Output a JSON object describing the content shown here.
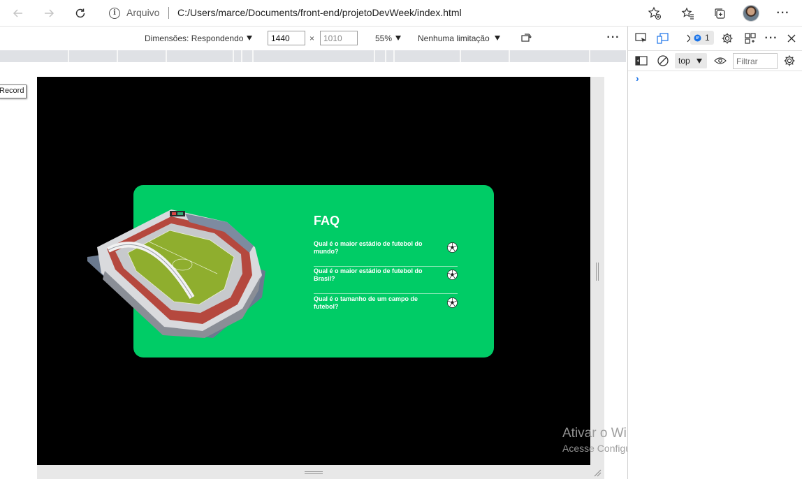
{
  "browser": {
    "site_label": "Arquivo",
    "url": "C:/Users/marce/Documents/front-end/projetoDevWeek/index.html",
    "icons": [
      "back-icon",
      "forward-icon",
      "refresh-icon",
      "info-icon",
      "add-favorite-icon",
      "favorites-icon",
      "collections-icon",
      "avatar",
      "more-icon"
    ]
  },
  "device_toolbar": {
    "dimensions_label": "Dimensões: Respondendo",
    "width_value": "1440",
    "height_value": "1010",
    "times": "×",
    "zoom": "55%",
    "throttle": "Nenhuma limitação"
  },
  "record_label": "Record",
  "page": {
    "faq_title": "FAQ",
    "questions": [
      "Qual é o maior estádio de futebol do mundo?",
      "Qual é o maior estádio de futebol do Brasil?",
      "Qual é o tamanho de um campo de futebol?"
    ],
    "accent_color": "#00cc66"
  },
  "watermark": {
    "title": "Ativar o Windows",
    "subtitle": "Acesse Configurações para ativar o Windows."
  },
  "devtools": {
    "issues_count": "1",
    "context": "top",
    "filter_placeholder": "Filtrar",
    "prompt": "›"
  }
}
